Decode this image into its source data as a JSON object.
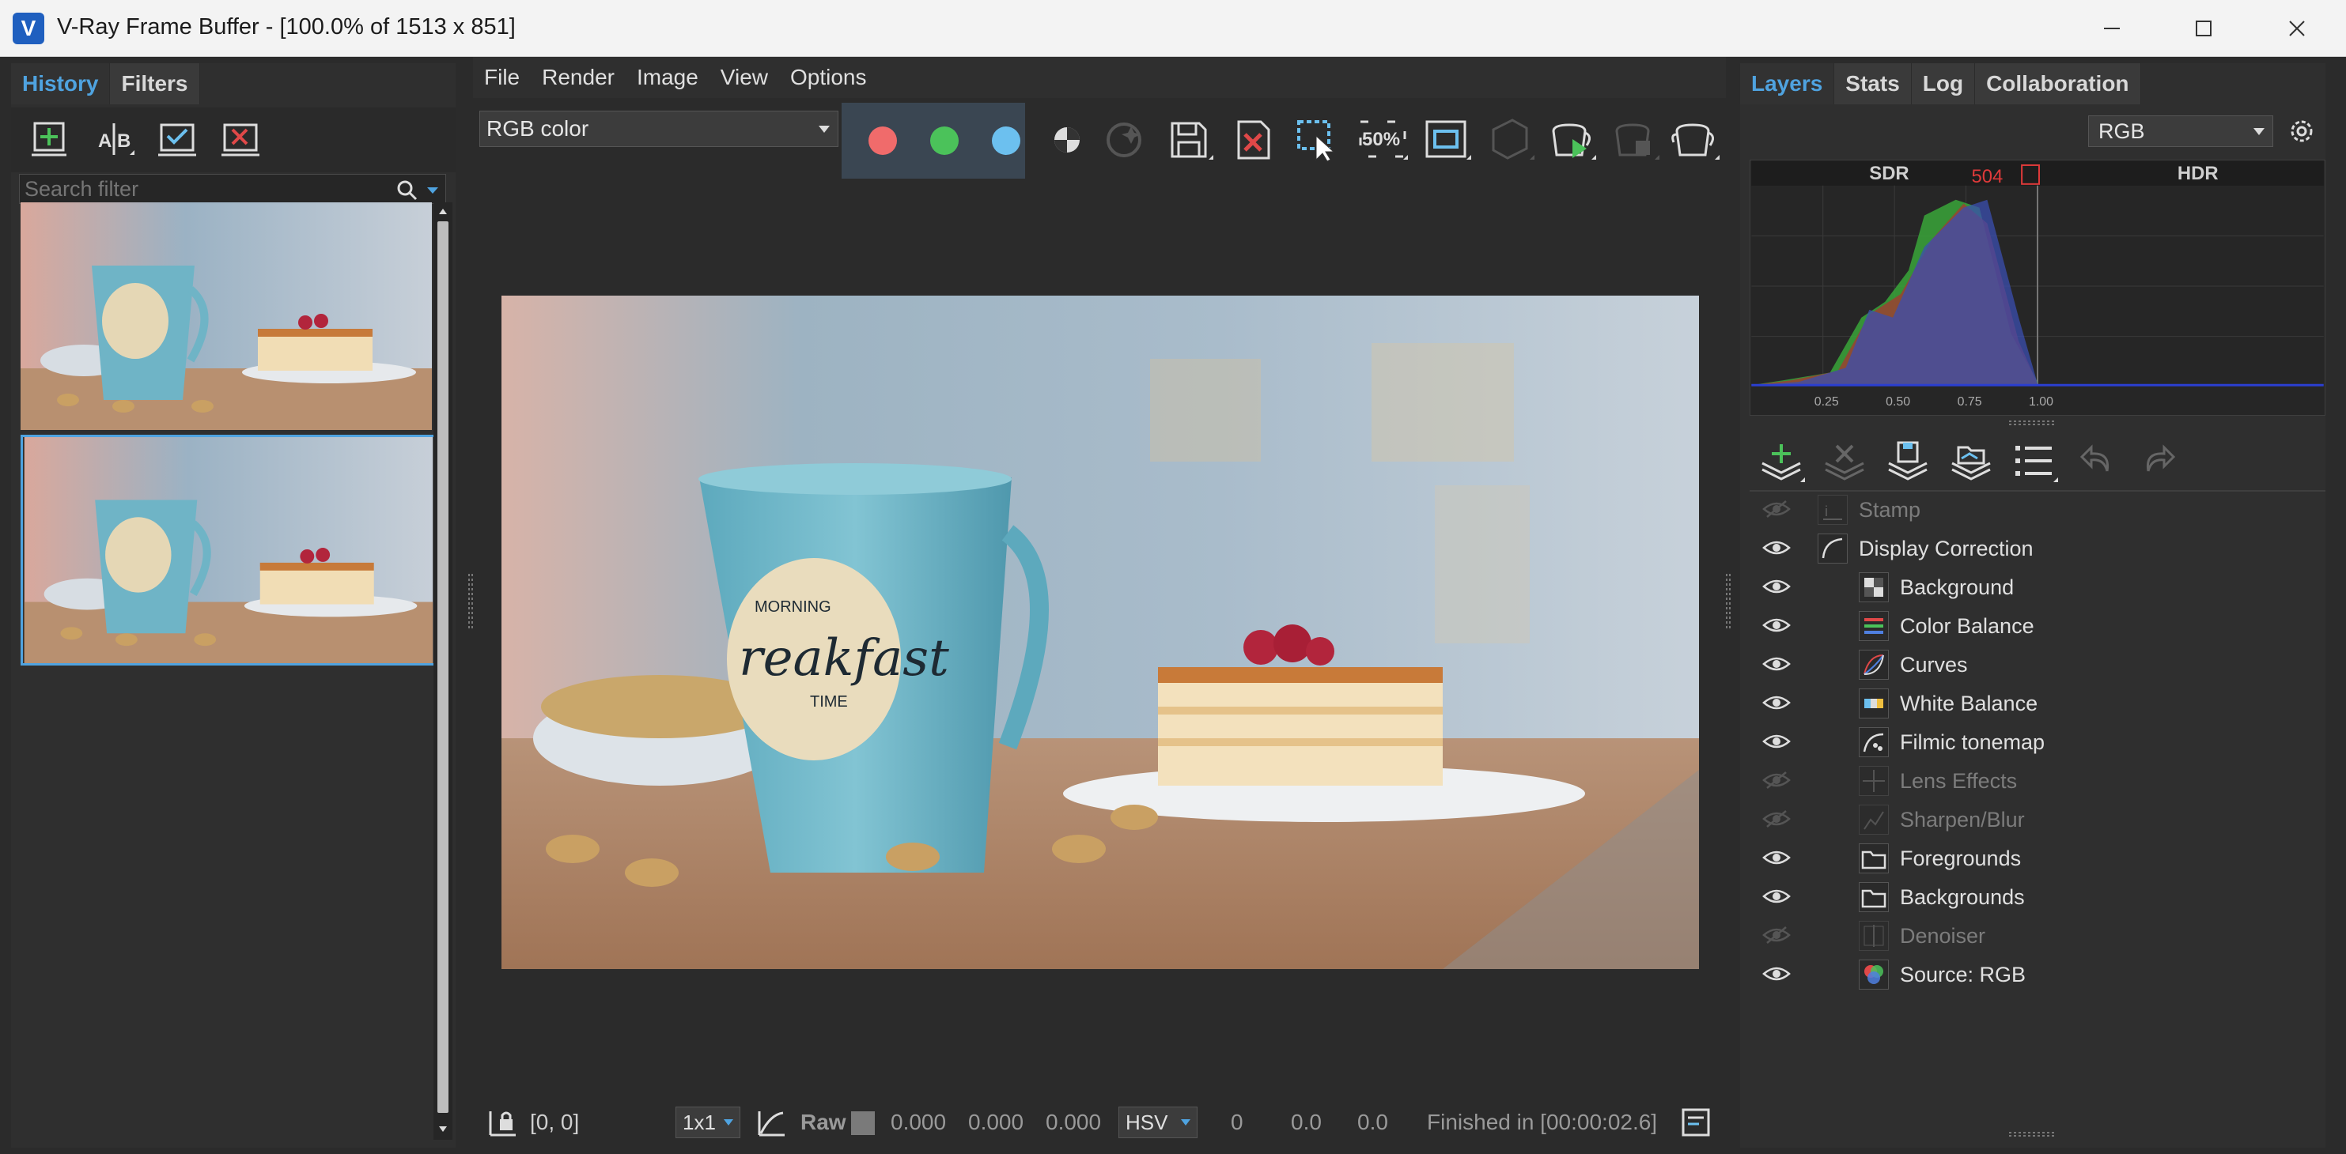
{
  "window": {
    "title": "V-Ray Frame Buffer - [100.0% of 1513 x 851]",
    "app_icon_letter": "V"
  },
  "left_panel": {
    "tabs": [
      {
        "label": "History",
        "active": true
      },
      {
        "label": "Filters",
        "active": false
      }
    ],
    "search_placeholder": "Search filter",
    "toolbar_icons": [
      "add-history-icon",
      "ab-compare-icon",
      "load-history-icon",
      "remove-history-icon"
    ]
  },
  "menu": {
    "items": [
      "File",
      "Render",
      "Image",
      "View",
      "Options"
    ]
  },
  "toolbar": {
    "channel_value": "RGB color",
    "zoom_label": "50%"
  },
  "statusbar": {
    "coords": "[0, 0]",
    "sampling": "1x1",
    "raw_label": "Raw",
    "rgb_values": [
      "0.000",
      "0.000",
      "0.000"
    ],
    "color_mode": "HSV",
    "hsv_values": [
      "0",
      "0.0",
      "0.0"
    ],
    "status_text": "Finished in [00:00:02.6]"
  },
  "right_panel": {
    "tabs": [
      {
        "label": "Layers",
        "active": true
      },
      {
        "label": "Stats",
        "active": false
      },
      {
        "label": "Log",
        "active": false
      },
      {
        "label": "Collaboration",
        "active": false
      }
    ],
    "channel_select": "RGB",
    "histogram": {
      "sdr_label": "SDR",
      "hdr_label": "HDR",
      "marker_value": "504",
      "ticks": [
        "0.25",
        "0.50",
        "0.75",
        "1.00"
      ]
    },
    "layers": [
      {
        "name": "Stamp",
        "enabled": false,
        "indent": 0,
        "icon": "stamp-icon"
      },
      {
        "name": "Display Correction",
        "enabled": true,
        "indent": 0,
        "icon": "display-correction-icon"
      },
      {
        "name": "Background",
        "enabled": true,
        "indent": 1,
        "icon": "checker-icon"
      },
      {
        "name": "Color Balance",
        "enabled": true,
        "indent": 1,
        "icon": "color-balance-icon"
      },
      {
        "name": "Curves",
        "enabled": true,
        "indent": 1,
        "icon": "curves-icon"
      },
      {
        "name": "White Balance",
        "enabled": true,
        "indent": 1,
        "icon": "white-balance-icon"
      },
      {
        "name": "Filmic tonemap",
        "enabled": true,
        "indent": 1,
        "icon": "filmic-icon"
      },
      {
        "name": "Lens Effects",
        "enabled": false,
        "indent": 1,
        "icon": "lens-effects-icon"
      },
      {
        "name": "Sharpen/Blur",
        "enabled": false,
        "indent": 1,
        "icon": "sharpen-icon"
      },
      {
        "name": "Foregrounds",
        "enabled": true,
        "indent": 1,
        "icon": "folder-icon"
      },
      {
        "name": "Backgrounds",
        "enabled": true,
        "indent": 1,
        "icon": "folder-icon"
      },
      {
        "name": "Denoiser",
        "enabled": false,
        "indent": 1,
        "icon": "denoiser-icon"
      },
      {
        "name": "Source: RGB",
        "enabled": true,
        "indent": 1,
        "icon": "source-rgb-icon"
      }
    ]
  },
  "colors": {
    "accent": "#4fa3e0",
    "background": "#2b2b2b",
    "red_channel": "#f06b6b",
    "green_channel": "#4bc25a",
    "blue_channel": "#6cc0ef"
  }
}
